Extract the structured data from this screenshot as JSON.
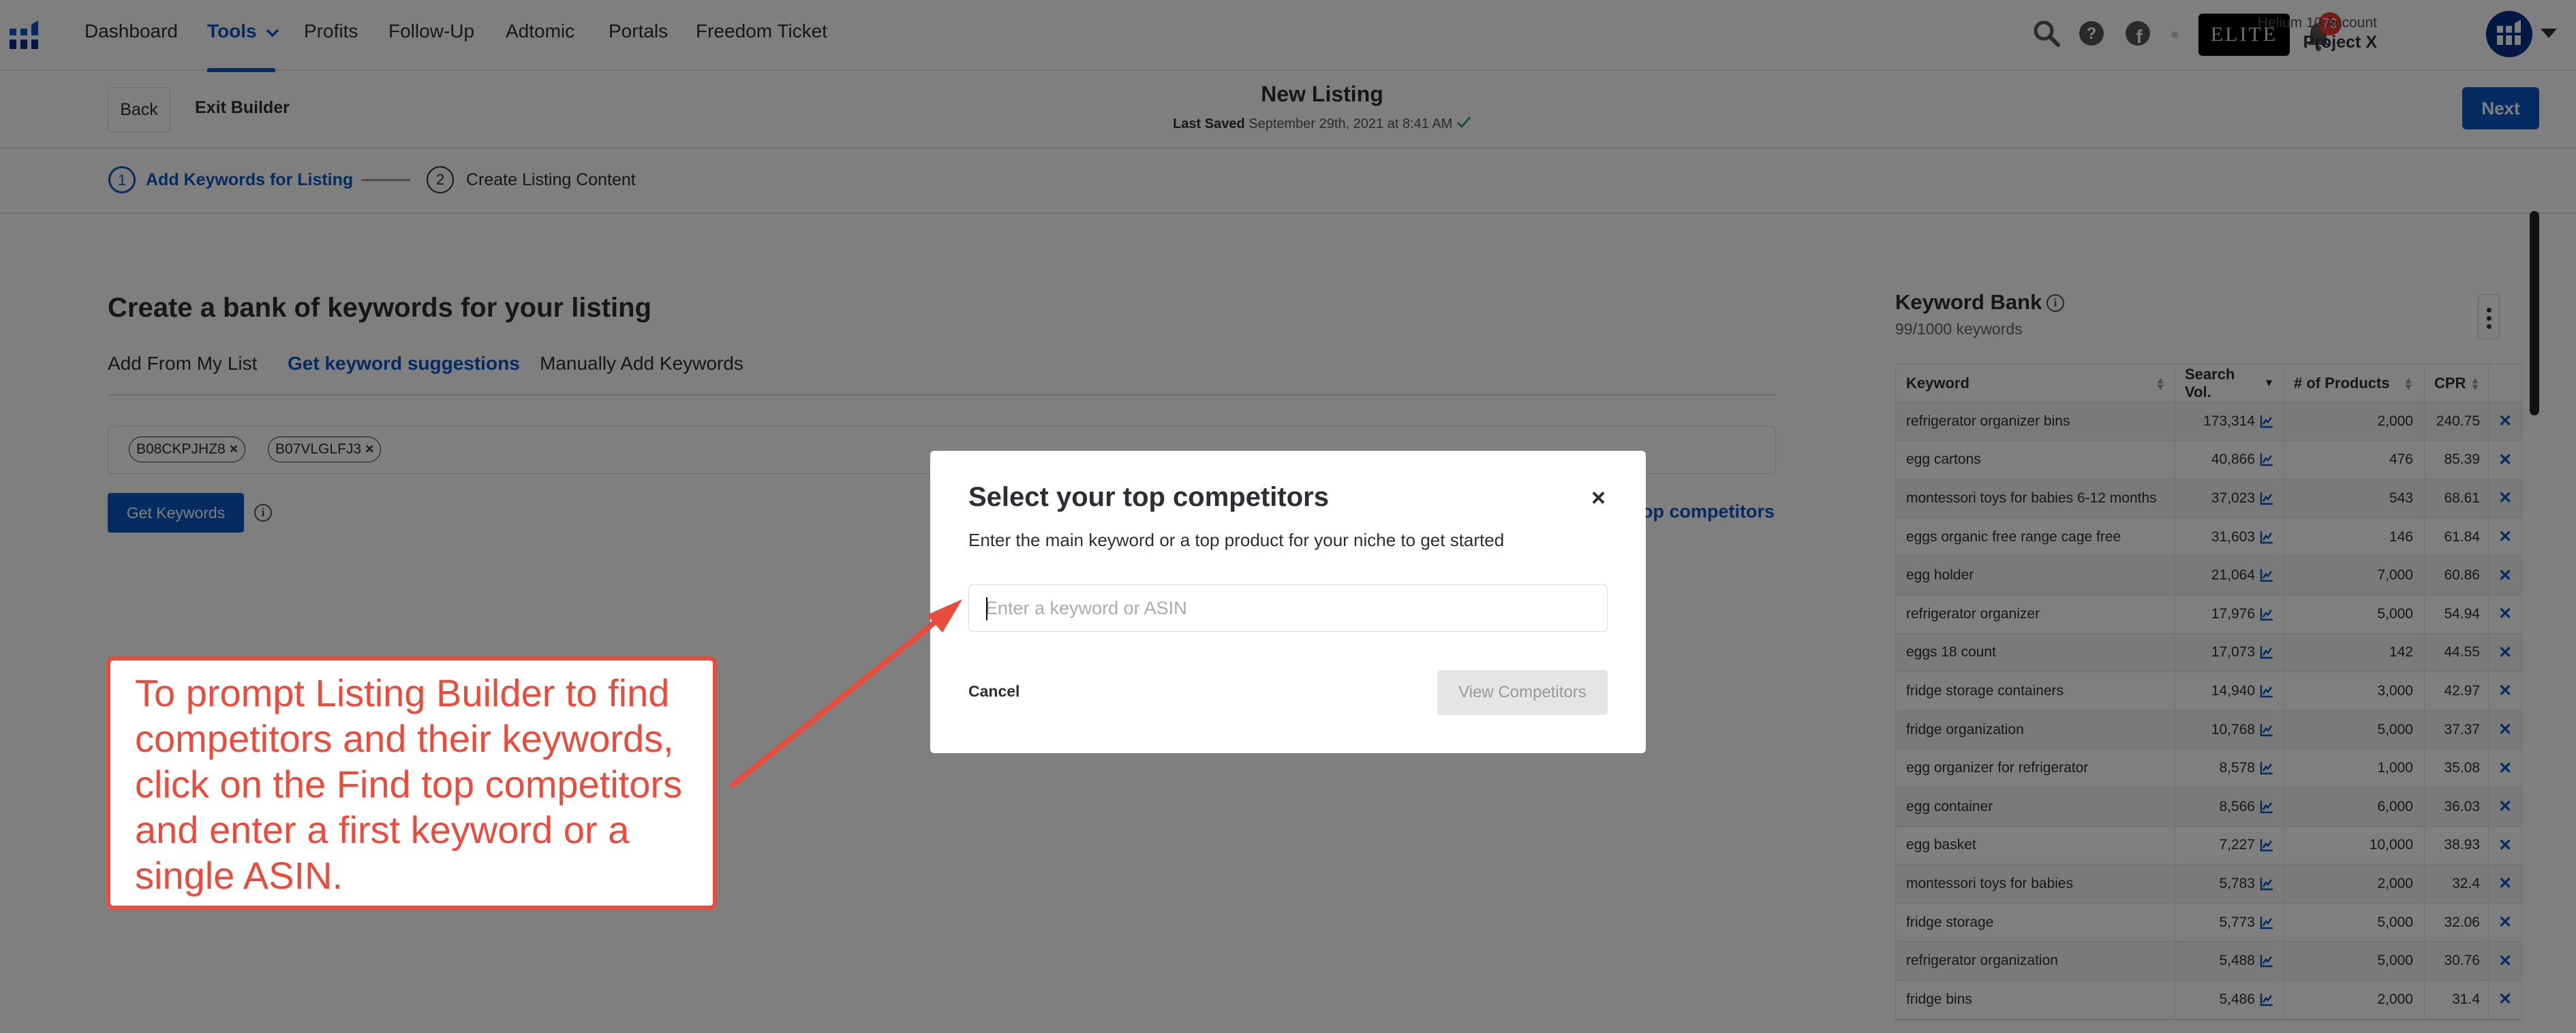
{
  "nav": {
    "items": [
      {
        "label": "Dashboard",
        "active": false
      },
      {
        "label": "Tools",
        "active": true
      },
      {
        "label": "Profits",
        "active": false
      },
      {
        "label": "Follow-Up",
        "active": false
      },
      {
        "label": "Adtomic",
        "active": false
      },
      {
        "label": "Portals",
        "active": false
      },
      {
        "label": "Freedom Ticket",
        "active": false
      }
    ],
    "icons": [
      "search-icon",
      "help-icon",
      "facebook-icon"
    ],
    "elite_badge": "ELITE",
    "notification_count": "79",
    "account_label": "Helium 10 Account",
    "account_name": "Project X"
  },
  "builder": {
    "back_label": "Back",
    "exit_label": "Exit Builder",
    "title": "New Listing",
    "last_saved_label": "Last Saved",
    "last_saved_value": "September 29th, 2021 at 8:41 AM",
    "next_label": "Next",
    "steps": [
      {
        "number": "1",
        "label": "Add Keywords for Listing",
        "active": true
      },
      {
        "number": "2",
        "label": "Create Listing Content",
        "active": false
      }
    ]
  },
  "main": {
    "heading": "Create a bank of keywords for your listing",
    "tabs": [
      {
        "label": "Add From My List",
        "active": false
      },
      {
        "label": "Get keyword suggestions",
        "active": true
      },
      {
        "label": "Manually Add Keywords",
        "active": false
      }
    ],
    "asins": [
      "B08CKPJHZ8",
      "B07VLGLFJ3"
    ],
    "chip_remove": "×",
    "get_keywords_label": "Get Keywords",
    "info_glyph": "i",
    "find_competitors_label": "Find top competitors"
  },
  "keyword_bank": {
    "title": "Keyword Bank",
    "count": "99/1000 keywords",
    "columns": [
      "Keyword",
      "Search Vol.",
      "# of Products",
      "CPR"
    ],
    "sorted_column": "Search Vol.",
    "rows": [
      {
        "keyword": "refrigerator organizer bins",
        "search_vol": "173,314",
        "products": "2,000",
        "cpr": "240.75"
      },
      {
        "keyword": "egg cartons",
        "search_vol": "40,866",
        "products": "476",
        "cpr": "85.39"
      },
      {
        "keyword": "montessori toys for babies 6-12 months",
        "search_vol": "37,023",
        "products": "543",
        "cpr": "68.61"
      },
      {
        "keyword": "eggs organic free range cage free",
        "search_vol": "31,603",
        "products": "146",
        "cpr": "61.84"
      },
      {
        "keyword": "egg holder",
        "search_vol": "21,064",
        "products": "7,000",
        "cpr": "60.86"
      },
      {
        "keyword": "refrigerator organizer",
        "search_vol": "17,976",
        "products": "5,000",
        "cpr": "54.94"
      },
      {
        "keyword": "eggs 18 count",
        "search_vol": "17,073",
        "products": "142",
        "cpr": "44.55"
      },
      {
        "keyword": "fridge storage containers",
        "search_vol": "14,940",
        "products": "3,000",
        "cpr": "42.97"
      },
      {
        "keyword": "fridge organization",
        "search_vol": "10,768",
        "products": "5,000",
        "cpr": "37.37"
      },
      {
        "keyword": "egg organizer for refrigerator",
        "search_vol": "8,578",
        "products": "1,000",
        "cpr": "35.08"
      },
      {
        "keyword": "egg container",
        "search_vol": "8,566",
        "products": "6,000",
        "cpr": "36.03"
      },
      {
        "keyword": "egg basket",
        "search_vol": "7,227",
        "products": "10,000",
        "cpr": "38.93"
      },
      {
        "keyword": "montessori toys for babies",
        "search_vol": "5,783",
        "products": "2,000",
        "cpr": "32.4"
      },
      {
        "keyword": "fridge storage",
        "search_vol": "5,773",
        "products": "5,000",
        "cpr": "32.06"
      },
      {
        "keyword": "refrigerator organization",
        "search_vol": "5,488",
        "products": "5,000",
        "cpr": "30.76"
      },
      {
        "keyword": "fridge bins",
        "search_vol": "5,486",
        "products": "2,000",
        "cpr": "31.4"
      }
    ],
    "delete_glyph": "✕"
  },
  "modal": {
    "title": "Select your top competitors",
    "close_glyph": "×",
    "subtitle": "Enter the main keyword or a top product for your niche to get started",
    "input_placeholder": "Enter a keyword or ASIN",
    "input_value": "",
    "cancel_label": "Cancel",
    "view_label": "View Competitors"
  },
  "annotation": {
    "text": "To prompt Listing Builder to find competitors and their keywords, click on the Find top competitors and enter a first keyword or a single ASIN.",
    "color": "#e74c3c"
  },
  "colors": {
    "brand_blue": "#0a58c2",
    "navy": "#003087",
    "annotation_red": "#e74c3c",
    "success_green": "#2aa56b"
  }
}
